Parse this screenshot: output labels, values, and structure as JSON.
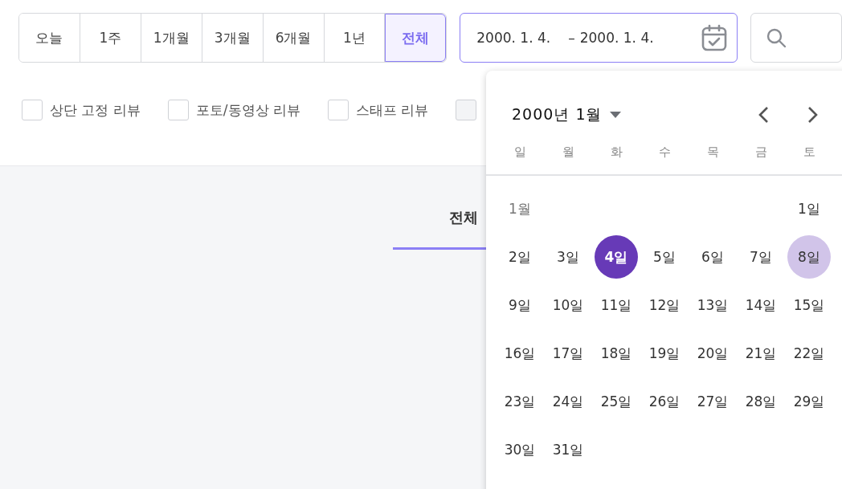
{
  "period_buttons": [
    {
      "label": "오늘",
      "selected": false
    },
    {
      "label": "1주",
      "selected": false
    },
    {
      "label": "1개월",
      "selected": false
    },
    {
      "label": "3개월",
      "selected": false
    },
    {
      "label": "6개월",
      "selected": false
    },
    {
      "label": "1년",
      "selected": false
    },
    {
      "label": "전체",
      "selected": true
    }
  ],
  "date_range": {
    "start": "2000. 1. 4.",
    "separator": "–",
    "end": "2000. 1. 4.",
    "focused": true
  },
  "filters": [
    {
      "label": "상단 고정 리뷰",
      "checked": false,
      "disabled": false
    },
    {
      "label": "포토/동영상 리뷰",
      "checked": false,
      "disabled": false
    },
    {
      "label": "스태프 리뷰",
      "checked": false,
      "disabled": false
    },
    {
      "checked": false,
      "disabled": true
    }
  ],
  "content_tabs": [
    {
      "label": "전체",
      "selected": true
    }
  ],
  "calendar": {
    "title": "2000년 1월",
    "weekdays": [
      "일",
      "월",
      "화",
      "수",
      "목",
      "금",
      "토"
    ],
    "weeks": [
      [
        {
          "kind": "month",
          "label": "1월"
        },
        {
          "kind": "blank"
        },
        {
          "kind": "blank"
        },
        {
          "kind": "blank"
        },
        {
          "kind": "blank"
        },
        {
          "kind": "blank"
        },
        {
          "kind": "day",
          "label": "1일",
          "selected": false,
          "highlighted": false
        }
      ],
      [
        {
          "kind": "day",
          "label": "2일",
          "selected": false,
          "highlighted": false
        },
        {
          "kind": "day",
          "label": "3일",
          "selected": false,
          "highlighted": false
        },
        {
          "kind": "day",
          "label": "4일",
          "selected": true,
          "highlighted": false
        },
        {
          "kind": "day",
          "label": "5일",
          "selected": false,
          "highlighted": false
        },
        {
          "kind": "day",
          "label": "6일",
          "selected": false,
          "highlighted": false
        },
        {
          "kind": "day",
          "label": "7일",
          "selected": false,
          "highlighted": false
        },
        {
          "kind": "day",
          "label": "8일",
          "selected": false,
          "highlighted": true
        }
      ],
      [
        {
          "kind": "day",
          "label": "9일",
          "selected": false,
          "highlighted": false
        },
        {
          "kind": "day",
          "label": "10일",
          "selected": false,
          "highlighted": false
        },
        {
          "kind": "day",
          "label": "11일",
          "selected": false,
          "highlighted": false
        },
        {
          "kind": "day",
          "label": "12일",
          "selected": false,
          "highlighted": false
        },
        {
          "kind": "day",
          "label": "13일",
          "selected": false,
          "highlighted": false
        },
        {
          "kind": "day",
          "label": "14일",
          "selected": false,
          "highlighted": false
        },
        {
          "kind": "day",
          "label": "15일",
          "selected": false,
          "highlighted": false
        }
      ],
      [
        {
          "kind": "day",
          "label": "16일",
          "selected": false,
          "highlighted": false
        },
        {
          "kind": "day",
          "label": "17일",
          "selected": false,
          "highlighted": false
        },
        {
          "kind": "day",
          "label": "18일",
          "selected": false,
          "highlighted": false
        },
        {
          "kind": "day",
          "label": "19일",
          "selected": false,
          "highlighted": false
        },
        {
          "kind": "day",
          "label": "20일",
          "selected": false,
          "highlighted": false
        },
        {
          "kind": "day",
          "label": "21일",
          "selected": false,
          "highlighted": false
        },
        {
          "kind": "day",
          "label": "22일",
          "selected": false,
          "highlighted": false
        }
      ],
      [
        {
          "kind": "day",
          "label": "23일",
          "selected": false,
          "highlighted": false
        },
        {
          "kind": "day",
          "label": "24일",
          "selected": false,
          "highlighted": false
        },
        {
          "kind": "day",
          "label": "25일",
          "selected": false,
          "highlighted": false
        },
        {
          "kind": "day",
          "label": "26일",
          "selected": false,
          "highlighted": false
        },
        {
          "kind": "day",
          "label": "27일",
          "selected": false,
          "highlighted": false
        },
        {
          "kind": "day",
          "label": "28일",
          "selected": false,
          "highlighted": false
        },
        {
          "kind": "day",
          "label": "29일",
          "selected": false,
          "highlighted": false
        }
      ],
      [
        {
          "kind": "day",
          "label": "30일",
          "selected": false,
          "highlighted": false
        },
        {
          "kind": "day",
          "label": "31일",
          "selected": false,
          "highlighted": false
        }
      ]
    ]
  }
}
